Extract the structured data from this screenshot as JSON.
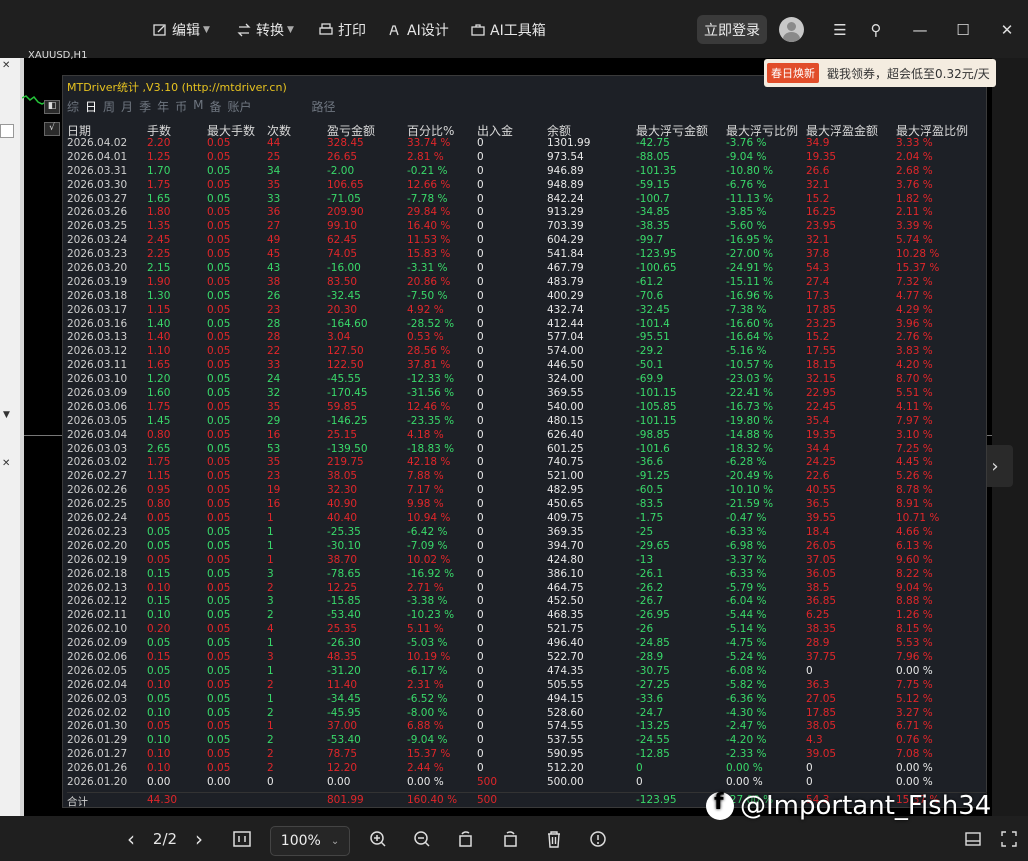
{
  "toolbar": {
    "edit": "编辑",
    "convert": "转换",
    "print": "打印",
    "ai_design": "AI设计",
    "ai_tools": "AI工具箱",
    "login": "立即登录"
  },
  "promo": {
    "tag": "春日焕新",
    "text": "戳我领券，超会低至0.32元/天"
  },
  "symbol": "XAUUSD,H1",
  "panel": {
    "title": "MTDriver统计 ,V3.10 (http://mtdriver.cn)",
    "tabs": [
      "综",
      "日",
      "周",
      "月",
      "季",
      "年",
      "币",
      "M",
      "备",
      "账户",
      "",
      "路径"
    ],
    "headers": [
      "日期",
      "手数",
      "最大手数",
      "次数",
      "盈亏金额",
      "百分比%",
      "出入金",
      "余额",
      "最大浮亏金额",
      "最大浮亏比例",
      "最大浮盈金额",
      "最大浮盈比例"
    ]
  },
  "rows": [
    [
      "2026.04.02",
      "2.20",
      "0.05",
      "44",
      "328.45",
      "33.74 %",
      "0",
      "1301.99",
      "-42.75",
      "-3.76 %",
      "34.9",
      "3.33 %",
      "r"
    ],
    [
      "2026.04.01",
      "1.25",
      "0.05",
      "25",
      "26.65",
      "2.81 %",
      "0",
      "973.54",
      "-88.05",
      "-9.04 %",
      "19.35",
      "2.04 %",
      "r"
    ],
    [
      "2026.03.31",
      "1.70",
      "0.05",
      "34",
      "-2.00",
      "-0.21 %",
      "0",
      "946.89",
      "-101.35",
      "-10.80 %",
      "26.6",
      "2.68 %",
      "g"
    ],
    [
      "2026.03.30",
      "1.75",
      "0.05",
      "35",
      "106.65",
      "12.66 %",
      "0",
      "948.89",
      "-59.15",
      "-6.76 %",
      "32.1",
      "3.76 %",
      "r"
    ],
    [
      "2026.03.27",
      "1.65",
      "0.05",
      "33",
      "-71.05",
      "-7.78 %",
      "0",
      "842.24",
      "-100.7",
      "-11.13 %",
      "15.2",
      "1.82 %",
      "g"
    ],
    [
      "2026.03.26",
      "1.80",
      "0.05",
      "36",
      "209.90",
      "29.84 %",
      "0",
      "913.29",
      "-34.85",
      "-3.85 %",
      "16.25",
      "2.11 %",
      "r"
    ],
    [
      "2026.03.25",
      "1.35",
      "0.05",
      "27",
      "99.10",
      "16.40 %",
      "0",
      "703.39",
      "-38.35",
      "-5.60 %",
      "23.95",
      "3.39 %",
      "r"
    ],
    [
      "2026.03.24",
      "2.45",
      "0.05",
      "49",
      "62.45",
      "11.53 %",
      "0",
      "604.29",
      "-99.7",
      "-16.95 %",
      "32.1",
      "5.74 %",
      "r"
    ],
    [
      "2026.03.23",
      "2.25",
      "0.05",
      "45",
      "74.05",
      "15.83 %",
      "0",
      "541.84",
      "-123.95",
      "-27.00 %",
      "37.8",
      "10.28 %",
      "r"
    ],
    [
      "2026.03.20",
      "2.15",
      "0.05",
      "43",
      "-16.00",
      "-3.31 %",
      "0",
      "467.79",
      "-100.65",
      "-24.91 %",
      "54.3",
      "15.37 %",
      "g"
    ],
    [
      "2026.03.19",
      "1.90",
      "0.05",
      "38",
      "83.50",
      "20.86 %",
      "0",
      "483.79",
      "-61.2",
      "-15.11 %",
      "27.4",
      "7.32 %",
      "r"
    ],
    [
      "2026.03.18",
      "1.30",
      "0.05",
      "26",
      "-32.45",
      "-7.50 %",
      "0",
      "400.29",
      "-70.6",
      "-16.96 %",
      "17.3",
      "4.77 %",
      "g"
    ],
    [
      "2026.03.17",
      "1.15",
      "0.05",
      "23",
      "20.30",
      "4.92 %",
      "0",
      "432.74",
      "-32.45",
      "-7.38 %",
      "17.85",
      "4.29 %",
      "r"
    ],
    [
      "2026.03.16",
      "1.40",
      "0.05",
      "28",
      "-164.60",
      "-28.52 %",
      "0",
      "412.44",
      "-101.4",
      "-16.60 %",
      "23.25",
      "3.96 %",
      "g"
    ],
    [
      "2026.03.13",
      "1.40",
      "0.05",
      "28",
      "3.04",
      "0.53 %",
      "0",
      "577.04",
      "-95.51",
      "-16.64 %",
      "15.2",
      "2.76 %",
      "r"
    ],
    [
      "2026.03.12",
      "1.10",
      "0.05",
      "22",
      "127.50",
      "28.56 %",
      "0",
      "574.00",
      "-29.2",
      "-5.16 %",
      "17.55",
      "3.83 %",
      "r"
    ],
    [
      "2026.03.11",
      "1.65",
      "0.05",
      "33",
      "122.50",
      "37.81 %",
      "0",
      "446.50",
      "-50.1",
      "-10.57 %",
      "18.15",
      "4.20 %",
      "r"
    ],
    [
      "2026.03.10",
      "1.20",
      "0.05",
      "24",
      "-45.55",
      "-12.33 %",
      "0",
      "324.00",
      "-69.9",
      "-23.03 %",
      "32.15",
      "8.70 %",
      "g"
    ],
    [
      "2026.03.09",
      "1.60",
      "0.05",
      "32",
      "-170.45",
      "-31.56 %",
      "0",
      "369.55",
      "-101.15",
      "-22.41 %",
      "22.95",
      "5.51 %",
      "g"
    ],
    [
      "2026.03.06",
      "1.75",
      "0.05",
      "35",
      "59.85",
      "12.46 %",
      "0",
      "540.00",
      "-105.85",
      "-16.73 %",
      "22.45",
      "4.11 %",
      "r"
    ],
    [
      "2026.03.05",
      "1.45",
      "0.05",
      "29",
      "-146.25",
      "-23.35 %",
      "0",
      "480.15",
      "-101.15",
      "-19.80 %",
      "35.4",
      "7.97 %",
      "g"
    ],
    [
      "2026.03.04",
      "0.80",
      "0.05",
      "16",
      "25.15",
      "4.18 %",
      "0",
      "626.40",
      "-98.85",
      "-14.88 %",
      "19.35",
      "3.10 %",
      "r"
    ],
    [
      "2026.03.03",
      "2.65",
      "0.05",
      "53",
      "-139.50",
      "-18.83 %",
      "0",
      "601.25",
      "-101.6",
      "-18.32 %",
      "34.4",
      "7.25 %",
      "g"
    ],
    [
      "2026.03.02",
      "1.75",
      "0.05",
      "35",
      "219.75",
      "42.18 %",
      "0",
      "740.75",
      "-36.6",
      "-6.28 %",
      "24.25",
      "4.45 %",
      "r"
    ],
    [
      "2026.02.27",
      "1.15",
      "0.05",
      "23",
      "38.05",
      "7.88 %",
      "0",
      "521.00",
      "-91.25",
      "-20.49 %",
      "22.6",
      "5.26 %",
      "r"
    ],
    [
      "2026.02.26",
      "0.95",
      "0.05",
      "19",
      "32.30",
      "7.17 %",
      "0",
      "482.95",
      "-60.5",
      "-10.10 %",
      "40.55",
      "8.78 %",
      "r"
    ],
    [
      "2026.02.25",
      "0.80",
      "0.05",
      "16",
      "40.90",
      "9.98 %",
      "0",
      "450.65",
      "-83.5",
      "-21.59 %",
      "36.5",
      "8.91 %",
      "r"
    ],
    [
      "2026.02.24",
      "0.05",
      "0.05",
      "1",
      "40.40",
      "10.94 %",
      "0",
      "409.75",
      "-1.75",
      "-0.47 %",
      "39.55",
      "10.71 %",
      "r"
    ],
    [
      "2026.02.23",
      "0.05",
      "0.05",
      "1",
      "-25.35",
      "-6.42 %",
      "0",
      "369.35",
      "-25",
      "-6.33 %",
      "18.4",
      "4.66 %",
      "g"
    ],
    [
      "2026.02.20",
      "0.05",
      "0.05",
      "1",
      "-30.10",
      "-7.09 %",
      "0",
      "394.70",
      "-29.65",
      "-6.98 %",
      "26.05",
      "6.13 %",
      "g"
    ],
    [
      "2026.02.19",
      "0.05",
      "0.05",
      "1",
      "38.70",
      "10.02 %",
      "0",
      "424.80",
      "-13",
      "-3.37 %",
      "37.05",
      "9.60 %",
      "r"
    ],
    [
      "2026.02.18",
      "0.15",
      "0.05",
      "3",
      "-78.65",
      "-16.92 %",
      "0",
      "386.10",
      "-26.1",
      "-6.33 %",
      "36.05",
      "8.22 %",
      "g"
    ],
    [
      "2026.02.13",
      "0.10",
      "0.05",
      "2",
      "12.25",
      "2.71 %",
      "0",
      "464.75",
      "-26.2",
      "-5.79 %",
      "38.5",
      "9.04 %",
      "r"
    ],
    [
      "2026.02.12",
      "0.15",
      "0.05",
      "3",
      "-15.85",
      "-3.38 %",
      "0",
      "452.50",
      "-26.7",
      "-6.04 %",
      "36.85",
      "8.88 %",
      "g"
    ],
    [
      "2026.02.11",
      "0.10",
      "0.05",
      "2",
      "-53.40",
      "-10.23 %",
      "0",
      "468.35",
      "-26.95",
      "-5.44 %",
      "6.25",
      "1.26 %",
      "g"
    ],
    [
      "2026.02.10",
      "0.20",
      "0.05",
      "4",
      "25.35",
      "5.11 %",
      "0",
      "521.75",
      "-26",
      "-5.14 %",
      "38.35",
      "8.15 %",
      "r"
    ],
    [
      "2026.02.09",
      "0.05",
      "0.05",
      "1",
      "-26.30",
      "-5.03 %",
      "0",
      "496.40",
      "-24.85",
      "-4.75 %",
      "28.9",
      "5.53 %",
      "g"
    ],
    [
      "2026.02.06",
      "0.15",
      "0.05",
      "3",
      "48.35",
      "10.19 %",
      "0",
      "522.70",
      "-28.9",
      "-5.24 %",
      "37.75",
      "7.96 %",
      "r"
    ],
    [
      "2026.02.05",
      "0.05",
      "0.05",
      "1",
      "-31.20",
      "-6.17 %",
      "0",
      "474.35",
      "-30.75",
      "-6.08 %",
      "0",
      "0.00 %",
      "g"
    ],
    [
      "2026.02.04",
      "0.10",
      "0.05",
      "2",
      "11.40",
      "2.31 %",
      "0",
      "505.55",
      "-27.25",
      "-5.82 %",
      "36.3",
      "7.75 %",
      "r"
    ],
    [
      "2026.02.03",
      "0.05",
      "0.05",
      "1",
      "-34.45",
      "-6.52 %",
      "0",
      "494.15",
      "-33.6",
      "-6.36 %",
      "27.05",
      "5.12 %",
      "g"
    ],
    [
      "2026.02.02",
      "0.10",
      "0.05",
      "2",
      "-45.95",
      "-8.00 %",
      "0",
      "528.60",
      "-24.7",
      "-4.30 %",
      "17.85",
      "3.27 %",
      "g"
    ],
    [
      "2026.01.30",
      "0.05",
      "0.05",
      "1",
      "37.00",
      "6.88 %",
      "0",
      "574.55",
      "-13.25",
      "-2.47 %",
      "38.05",
      "6.71 %",
      "r"
    ],
    [
      "2026.01.29",
      "0.10",
      "0.05",
      "2",
      "-53.40",
      "-9.04 %",
      "0",
      "537.55",
      "-24.55",
      "-4.20 %",
      "4.3",
      "0.76 %",
      "g"
    ],
    [
      "2026.01.27",
      "0.10",
      "0.05",
      "2",
      "78.75",
      "15.37 %",
      "0",
      "590.95",
      "-12.85",
      "-2.33 %",
      "39.05",
      "7.08 %",
      "r"
    ],
    [
      "2026.01.26",
      "0.10",
      "0.05",
      "2",
      "12.20",
      "2.44 %",
      "0",
      "512.20",
      "0",
      "0.00 %",
      "0",
      "0.00 %",
      "r"
    ],
    [
      "2026.01.20",
      "0.00",
      "0.00",
      "0",
      "0.00",
      "0.00 %",
      "500",
      "500.00",
      "0",
      "0.00 %",
      "0",
      "0.00 %",
      "w"
    ]
  ],
  "total": {
    "label": "合计",
    "lots": "44.30",
    "pnl": "801.99",
    "pct": "160.40 %",
    "deposit": "500",
    "maxloss": "-123.95",
    "maxloss_pct": "-27.00 %",
    "maxprofit": "54.3",
    "maxprofit_pct": "15.37 %"
  },
  "pager": {
    "page": "2/2",
    "zoom": "100%"
  },
  "watermark": "@Important_Fish34",
  "colors": {
    "profit": "#e0262a",
    "loss": "#39d96a",
    "title": "#e7c320"
  }
}
